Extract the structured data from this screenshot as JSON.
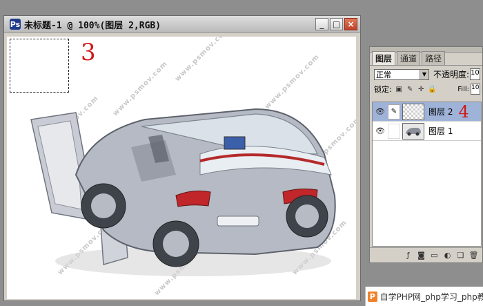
{
  "document": {
    "title": "未标题-1 @ 100%(图层 2,RGB)",
    "canvas_image": "car-cutaway-illustration",
    "watermark": "www.psmov.com",
    "annotation_3": "3"
  },
  "window_controls": {
    "minimize": "_",
    "maximize": "□",
    "close": "×"
  },
  "layers_panel": {
    "tabs": [
      {
        "label": "图层",
        "active": true
      },
      {
        "label": "通道",
        "active": false
      },
      {
        "label": "路径",
        "active": false
      }
    ],
    "blend_mode": "正常",
    "opacity_label": "不透明度:",
    "opacity_value": "10",
    "lock_label": "锁定:",
    "fill_label": "Fill:",
    "fill_value": "10",
    "layers": [
      {
        "name": "图层 2",
        "visible": true,
        "selected": true,
        "thumbnail": "transparent"
      },
      {
        "name": "图层 1",
        "visible": true,
        "selected": false,
        "thumbnail": "car"
      }
    ],
    "annotation_4": "4"
  },
  "site_badge": {
    "logo": "P",
    "text": "自学PHP网_php学习_php教程"
  },
  "colors": {
    "annotation": "#d01818",
    "selected_layer": "#9fb3d9",
    "panel_bg": "#d4d0c8"
  }
}
